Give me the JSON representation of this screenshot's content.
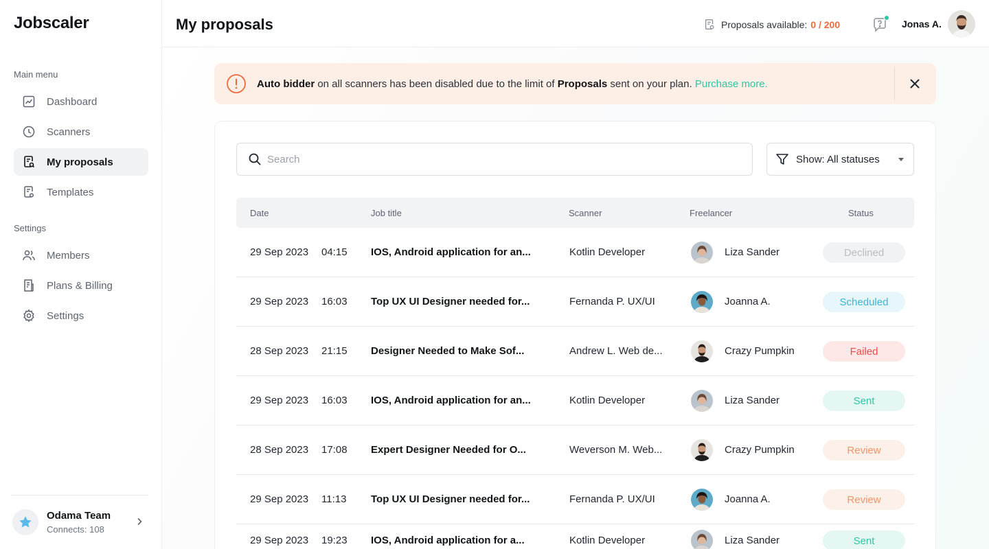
{
  "app": {
    "logo": "Jobscaler"
  },
  "sidebar": {
    "main_menu_label": "Main menu",
    "main_items": [
      {
        "label": "Dashboard",
        "icon": "chart-icon"
      },
      {
        "label": "Scanners",
        "icon": "clock-icon"
      },
      {
        "label": "My proposals",
        "icon": "proposal-icon",
        "active": true
      },
      {
        "label": "Templates",
        "icon": "template-icon"
      }
    ],
    "settings_label": "Settings",
    "settings_items": [
      {
        "label": "Members",
        "icon": "members-icon"
      },
      {
        "label": "Plans & Billing",
        "icon": "billing-icon"
      },
      {
        "label": "Settings",
        "icon": "gear-icon"
      }
    ],
    "team": {
      "name": "Odama Team",
      "connects": "Connects: 108"
    }
  },
  "header": {
    "title": "My proposals",
    "proposals_label": "Proposals available:",
    "proposals_count": "0 / 200",
    "user_name": "Jonas A."
  },
  "alert": {
    "strong_1": "Auto bidder",
    "text_1": " on all scanners has been disabled due to the limit of ",
    "strong_2": "Proposals",
    "text_2": " sent on your plan. ",
    "link": "Purchase more."
  },
  "toolbar": {
    "search_placeholder": "Search",
    "filter_label": "Show: All statuses"
  },
  "table": {
    "columns": [
      "Date",
      "Job title",
      "Scanner",
      "Freelancer",
      "Status"
    ],
    "rows": [
      {
        "date": "29 Sep 2023",
        "time": "04:15",
        "title": "IOS, Android application for an...",
        "scanner": "Kotlin Developer",
        "freelancer": "Liza Sander",
        "status": "Declined",
        "status_type": "declined"
      },
      {
        "date": "29 Sep 2023",
        "time": "16:03",
        "title": "Top UX UI Designer needed for...",
        "scanner": "Fernanda P. UX/UI",
        "freelancer": "Joanna A.",
        "status": "Scheduled",
        "status_type": "scheduled"
      },
      {
        "date": "28 Sep 2023",
        "time": "21:15",
        "title": "Designer Needed to Make Sof...",
        "scanner": "Andrew L. Web de...",
        "freelancer": "Crazy Pumpkin",
        "status": "Failed",
        "status_type": "failed"
      },
      {
        "date": "29 Sep 2023",
        "time": "16:03",
        "title": "IOS, Android application for an...",
        "scanner": "Kotlin Developer",
        "freelancer": "Liza Sander",
        "status": "Sent",
        "status_type": "sent"
      },
      {
        "date": "28 Sep 2023",
        "time": "17:08",
        "title": "Expert Designer Needed for O...",
        "scanner": "Weverson M. Web...",
        "freelancer": "Crazy Pumpkin",
        "status": "Review",
        "status_type": "review"
      },
      {
        "date": "29 Sep 2023",
        "time": "11:13",
        "title": "Top UX UI Designer needed for...",
        "scanner": "Fernanda P. UX/UI",
        "freelancer": "Joanna A.",
        "status": "Review",
        "status_type": "review"
      },
      {
        "date": "29 Sep 2023",
        "time": "19:23",
        "title": "IOS, Android application for a...",
        "scanner": "Kotlin Developer",
        "freelancer": "Liza Sander",
        "status": "Sent",
        "status_type": "sent"
      }
    ]
  },
  "colors": {
    "accent": "#2ec4a6",
    "warning": "#ef6a3a",
    "alert_bg": "#fdeee6",
    "status_declined": "#b7bcc4",
    "status_declined_bg": "#f1f2f4",
    "status_scheduled": "#3bb5d8",
    "status_scheduled_bg": "#e7f6fb",
    "status_failed": "#ea4b4b",
    "status_failed_bg": "#fde7e7",
    "status_sent": "#2ec4a6",
    "status_sent_bg": "#e4f7f3",
    "status_review": "#f4956a",
    "status_review_bg": "#fdf0e8"
  }
}
